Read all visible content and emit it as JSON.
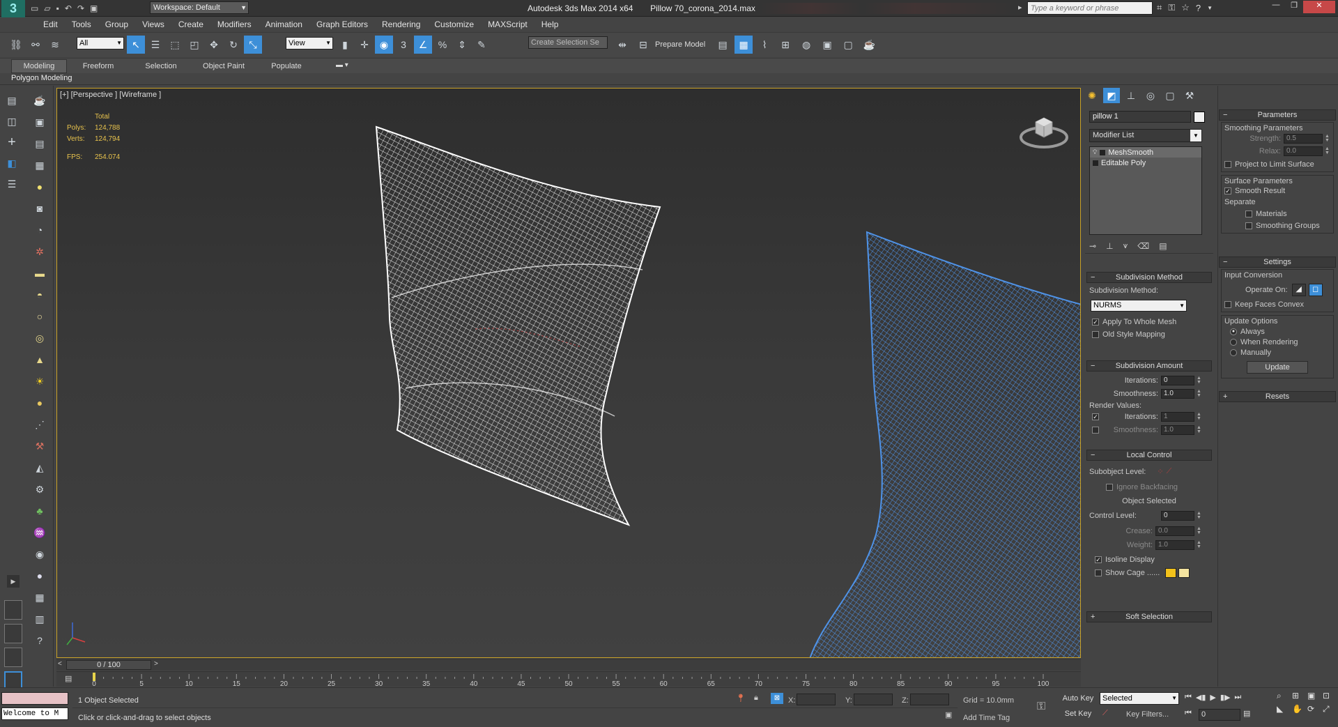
{
  "titlebar": {
    "workspace": "Workspace: Default",
    "app_title": "Autodesk 3ds Max  2014 x64",
    "file_title": "Pillow 70_corona_2014.max",
    "search_placeholder": "Type a keyword or phrase"
  },
  "menu": [
    "Edit",
    "Tools",
    "Group",
    "Views",
    "Create",
    "Modifiers",
    "Animation",
    "Graph Editors",
    "Rendering",
    "Customize",
    "MAXScript",
    "Help"
  ],
  "toolbar": {
    "filter_value": "All",
    "refcoord_value": "View",
    "selection_set_placeholder": "Create Selection Se",
    "prepare_model": "Prepare Model"
  },
  "ribbon": {
    "tabs": [
      "Modeling",
      "Freeform",
      "Selection",
      "Object Paint",
      "Populate"
    ],
    "active_tab": "Modeling",
    "sub_label": "Polygon Modeling"
  },
  "viewport": {
    "label": "[+] [Perspective ] [Wireframe ]",
    "stats_header": "Total",
    "polys_label": "Polys:",
    "polys_value": "124,788",
    "verts_label": "Verts:",
    "verts_value": "124,794",
    "fps_label": "FPS:",
    "fps_value": "254.074"
  },
  "command_panel": {
    "object_name": "pillow 1",
    "modifier_list": "Modifier List",
    "stack": [
      "MeshSmooth",
      "Editable Poly"
    ],
    "subdivision_method": {
      "title": "Subdivision Method",
      "label": "Subdivision Method:",
      "value": "NURMS",
      "apply_whole_mesh": "Apply To Whole Mesh",
      "old_style_mapping": "Old Style Mapping"
    },
    "subdivision_amount": {
      "title": "Subdivision Amount",
      "iterations_label": "Iterations:",
      "iterations_value": "0",
      "smoothness_label": "Smoothness:",
      "smoothness_value": "1.0",
      "render_values": "Render Values:",
      "r_iterations_label": "Iterations:",
      "r_iterations_value": "1",
      "r_smoothness_label": "Smoothness:",
      "r_smoothness_value": "1.0"
    },
    "local_control": {
      "title": "Local Control",
      "subobject_level": "Subobject Level:",
      "ignore_backfacing": "Ignore Backfacing",
      "object_selected": "Object Selected",
      "control_level_label": "Control Level:",
      "control_level_value": "0",
      "crease_label": "Crease:",
      "crease_value": "0.0",
      "weight_label": "Weight:",
      "weight_value": "1.0",
      "isoline_display": "Isoline Display",
      "show_cage": "Show Cage ......"
    },
    "soft_selection": "Soft Selection"
  },
  "params_panel": {
    "title": "Parameters",
    "smoothing_params": "Smoothing Parameters",
    "strength_label": "Strength:",
    "strength_value": "0.5",
    "relax_label": "Relax:",
    "relax_value": "0.0",
    "project_limit": "Project to Limit Surface",
    "surface_params": "Surface Parameters",
    "smooth_result": "Smooth Result",
    "separate": "Separate",
    "materials": "Materials",
    "smoothing_groups": "Smoothing Groups",
    "settings": "Settings",
    "input_conversion": "Input Conversion",
    "operate_on": "Operate On:",
    "keep_faces_convex": "Keep Faces Convex",
    "update_options": "Update Options",
    "always": "Always",
    "when_rendering": "When Rendering",
    "manually": "Manually",
    "update_button": "Update",
    "resets": "Resets"
  },
  "timeline": {
    "frame_counter": "0 / 100",
    "ticks": [
      "0",
      "5",
      "10",
      "15",
      "20",
      "25",
      "30",
      "35",
      "40",
      "45",
      "50",
      "55",
      "60",
      "65",
      "70",
      "75",
      "80",
      "85",
      "90",
      "95",
      "100"
    ]
  },
  "status": {
    "maxscript_text": "Welcome to M",
    "objects_selected": "1 Object Selected",
    "prompt": "Click or click-and-drag to select objects",
    "x_label": "X:",
    "y_label": "Y:",
    "z_label": "Z:",
    "grid": "Grid = 10.0mm",
    "add_time_tag": "Add Time Tag",
    "auto_key": "Auto Key",
    "set_key": "Set Key",
    "selected_value": "Selected",
    "key_filters": "Key Filters...",
    "frame_value": "0"
  },
  "colors": {
    "accent_blue": "#3d8fd8",
    "wire_blue": "#4f93e8",
    "viewport_border": "#c9a227",
    "cage_yellow": "#f3c21b",
    "cage_light": "#f4e4a0"
  }
}
